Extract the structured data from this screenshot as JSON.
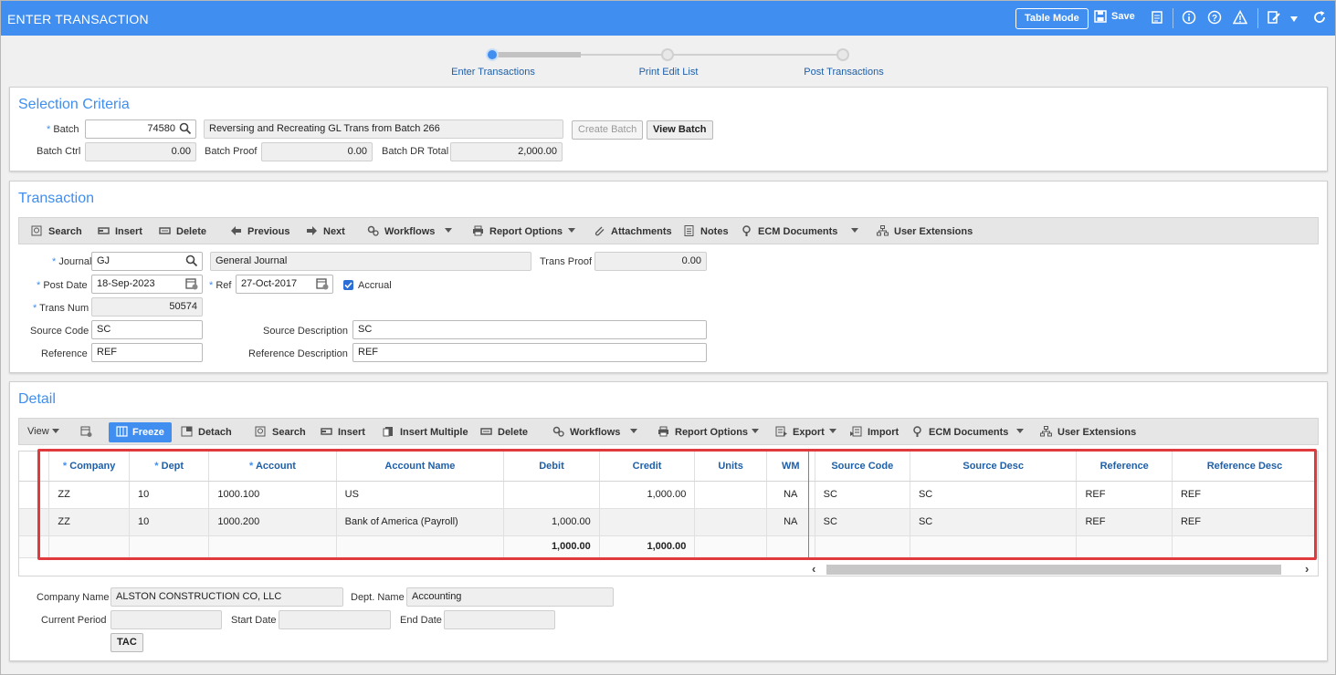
{
  "header": {
    "title": "ENTER TRANSACTION",
    "table_mode": "Table Mode",
    "save": "Save"
  },
  "steps": [
    {
      "label": "Enter Transactions",
      "active": true
    },
    {
      "label": "Print Edit List",
      "active": false
    },
    {
      "label": "Post Transactions",
      "active": false
    }
  ],
  "selection": {
    "title": "Selection Criteria",
    "batch_label": "Batch",
    "batch_value": "74580",
    "batch_desc": "Reversing and Recreating GL Trans from Batch 266",
    "create_batch": "Create Batch",
    "view_batch": "View Batch",
    "batch_ctrl_label": "Batch Ctrl",
    "batch_ctrl_value": "0.00",
    "batch_proof_label": "Batch Proof",
    "batch_proof_value": "0.00",
    "batch_dr_label": "Batch DR Total",
    "batch_dr_value": "2,000.00"
  },
  "transaction": {
    "title": "Transaction",
    "toolbar": {
      "search": "Search",
      "insert": "Insert",
      "delete": "Delete",
      "previous": "Previous",
      "next": "Next",
      "workflows": "Workflows",
      "report_options": "Report Options",
      "attachments": "Attachments",
      "notes": "Notes",
      "ecm": "ECM Documents",
      "user_ext": "User Extensions"
    },
    "journal_label": "Journal",
    "journal_value": "GJ",
    "journal_desc": "General Journal",
    "trans_proof_label": "Trans Proof",
    "trans_proof_value": "0.00",
    "post_date_label": "Post Date",
    "post_date_value": "18-Sep-2023",
    "ref_label": "Ref",
    "ref_value": "27-Oct-2017",
    "accrual_label": "Accrual",
    "trans_num_label": "Trans Num",
    "trans_num_value": "50574",
    "source_code_label": "Source Code",
    "source_code_value": "SC",
    "source_desc_label": "Source Description",
    "source_desc_value": "SC",
    "reference_label": "Reference",
    "reference_value": "REF",
    "reference_desc_label": "Reference Description",
    "reference_desc_value": "REF"
  },
  "detail": {
    "title": "Detail",
    "toolbar": {
      "view": "View",
      "freeze": "Freeze",
      "detach": "Detach",
      "search": "Search",
      "insert": "Insert",
      "insert_multiple": "Insert Multiple",
      "delete": "Delete",
      "workflows": "Workflows",
      "report_options": "Report Options",
      "export": "Export",
      "import": "Import",
      "ecm": "ECM Documents",
      "user_ext": "User Extensions"
    },
    "columns": [
      "* Company",
      "* Dept",
      "* Account",
      "Account Name",
      "Debit",
      "Credit",
      "Units",
      "WM",
      "Source Code",
      "Source Desc",
      "Reference",
      "Reference Desc"
    ],
    "rows": [
      [
        "ZZ",
        "10",
        "1000.100",
        "US",
        "",
        "1,000.00",
        "",
        "NA",
        "SC",
        "SC",
        "REF",
        "REF"
      ],
      [
        "ZZ",
        "10",
        "1000.200",
        "Bank of America (Payroll)",
        "1,000.00",
        "",
        "",
        "NA",
        "SC",
        "SC",
        "REF",
        "REF"
      ]
    ],
    "totals": [
      "",
      "",
      "",
      "",
      "1,000.00",
      "1,000.00",
      "",
      "",
      "",
      "",
      "",
      ""
    ],
    "company_name_label": "Company Name",
    "company_name_value": "ALSTON CONSTRUCTION CO, LLC",
    "dept_name_label": "Dept. Name",
    "dept_name_value": "Accounting",
    "current_period_label": "Current Period",
    "current_period_value": "",
    "start_date_label": "Start Date",
    "start_date_value": "",
    "end_date_label": "End Date",
    "end_date_value": "",
    "tac": "TAC"
  },
  "colors": {
    "accent": "#3f8ef0",
    "highlight": "#e0393e"
  }
}
